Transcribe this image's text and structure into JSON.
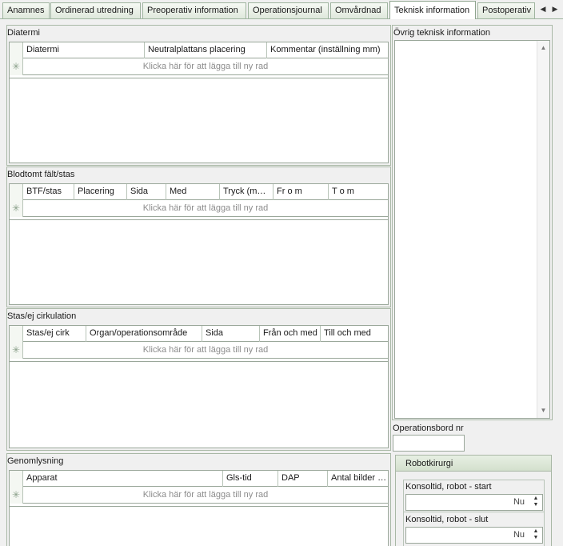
{
  "tabs": [
    {
      "label": "Anamnes"
    },
    {
      "label": "Ordinerad utredning"
    },
    {
      "label": "Preoperativ information"
    },
    {
      "label": "Operationsjournal"
    },
    {
      "label": "Omvårdnad"
    },
    {
      "label": "Teknisk information",
      "active": true
    },
    {
      "label": "Postoperativ"
    }
  ],
  "tab_scroll": {
    "left_icon": "◀",
    "right_icon": "▶"
  },
  "new_row_text": "Klicka här för att lägga till ny rad",
  "new_row_icon": "✳",
  "diatermi": {
    "title": "Diatermi",
    "columns": [
      "Diatermi",
      "Neutralplattans placering",
      "Kommentar (inställning mm)"
    ]
  },
  "blodtomt": {
    "title": "Blodtomt fält/stas",
    "columns": [
      "BTF/stas",
      "Placering",
      "Sida",
      "Med",
      "Tryck (m…",
      "Fr o m",
      "T o m"
    ]
  },
  "stas": {
    "title": "Stas/ej cirkulation",
    "columns": [
      "Stas/ej cirk",
      "Organ/operationsområde",
      "Sida",
      "Från och med",
      "Till och med"
    ]
  },
  "genomlysning": {
    "title": "Genomlysning",
    "columns": [
      "Apparat",
      "Gls-tid",
      "DAP",
      "Antal bilder …"
    ]
  },
  "ovrig": {
    "title": "Övrig teknisk information",
    "scroll_up": "▲",
    "scroll_down": "▼"
  },
  "operationsbord": {
    "label": "Operationsbord nr",
    "value": ""
  },
  "robot": {
    "title": "Robotkirurgi",
    "start_label": "Konsoltid, robot - start",
    "start_value": "Nu",
    "end_label": "Konsoltid, robot - slut",
    "end_value": "Nu",
    "spin_up": "▲",
    "spin_down": "▼"
  },
  "colors": {
    "accent_green": "#a9b8a6",
    "active_tab": "#ffffff"
  }
}
